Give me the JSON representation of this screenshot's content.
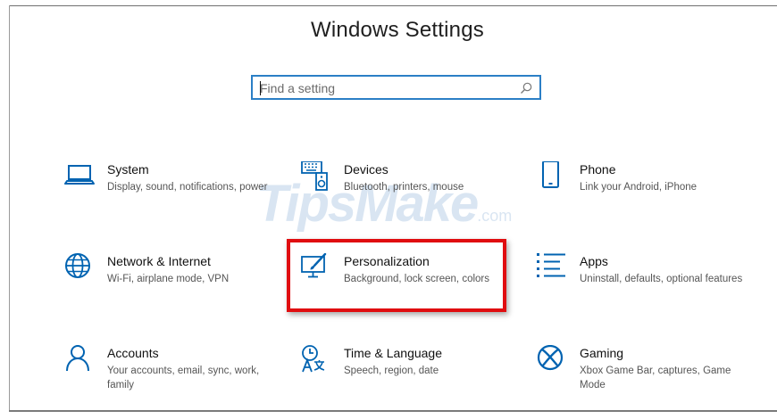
{
  "window": {
    "title": "Windows Settings"
  },
  "search": {
    "placeholder": "Find a setting"
  },
  "watermark": {
    "text": "TipsMake",
    "suffix": ".com"
  },
  "accent_color": "#0063b1",
  "highlight_color": "#e00d10",
  "tiles": [
    {
      "name": "System",
      "description": "Display, sound, notifications, power",
      "icon": "laptop-icon"
    },
    {
      "name": "Devices",
      "description": "Bluetooth, printers, mouse",
      "icon": "keyboard-speaker-icon"
    },
    {
      "name": "Phone",
      "description": "Link your Android, iPhone",
      "icon": "phone-icon"
    },
    {
      "name": "Network & Internet",
      "description": "Wi-Fi, airplane mode, VPN",
      "icon": "globe-icon"
    },
    {
      "name": "Personalization",
      "description": "Background, lock screen, colors",
      "icon": "paintbrush-icon"
    },
    {
      "name": "Apps",
      "description": "Uninstall, defaults, optional features",
      "icon": "apps-list-icon"
    },
    {
      "name": "Accounts",
      "description": "Your accounts, email, sync, work, family",
      "icon": "person-icon"
    },
    {
      "name": "Time & Language",
      "description": "Speech, region, date",
      "icon": "clock-language-icon"
    },
    {
      "name": "Gaming",
      "description": "Xbox Game Bar, captures, Game Mode",
      "icon": "xbox-icon"
    }
  ]
}
